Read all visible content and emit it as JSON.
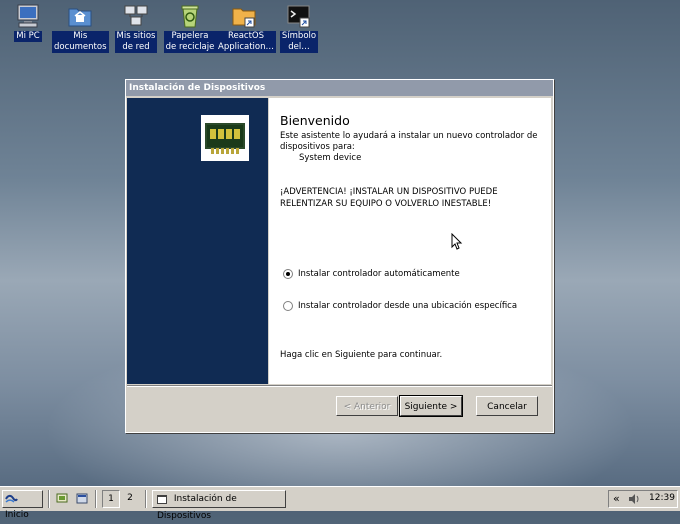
{
  "desktop": {
    "icons": [
      {
        "label": "Mi PC",
        "icon": "computer-icon"
      },
      {
        "label": "Mis\ndocumentos",
        "icon": "documents-folder-icon"
      },
      {
        "label": "Mis sitios\nde red",
        "icon": "network-places-icon"
      },
      {
        "label": "Papelera\nde reciclaje",
        "icon": "recycle-bin-icon"
      },
      {
        "label": "ReactOS\nApplication…",
        "icon": "folder-shortcut-icon"
      },
      {
        "label": "Símbolo\ndel…",
        "icon": "command-prompt-icon"
      }
    ]
  },
  "dialog": {
    "title": "Instalación de Dispositivos",
    "heading": "Bienvenido",
    "intro_line1": "Este asistente lo ayudará a instalar un nuevo controlador de",
    "intro_line2": "dispositivos para:",
    "device_name": "System device",
    "warning_line1": "¡ADVERTENCIA! ¡INSTALAR UN DISPOSITIVO PUEDE",
    "warning_line2": "RELENTIZAR SU EQUIPO O VOLVERLO INESTABLE!",
    "option_auto": "Instalar controlador automáticamente",
    "option_manual": "Instalar controlador desde una ubicación específica",
    "selected_option": "auto",
    "footer_hint": "Haga clic en Siguiente para continuar.",
    "buttons": {
      "back": "< Anterior",
      "next": "Siguiente >",
      "cancel": "Cancelar"
    }
  },
  "taskbar": {
    "start_label": "Inicio",
    "workspaces": [
      "1",
      "2"
    ],
    "task_label": "Instalación de Dispositivos",
    "clock": "12:39",
    "tray_expand": "«"
  },
  "colors": {
    "selection_blue": "#0a246a",
    "title_inactive": "#919aaa",
    "wizard_side": "#102b53"
  }
}
